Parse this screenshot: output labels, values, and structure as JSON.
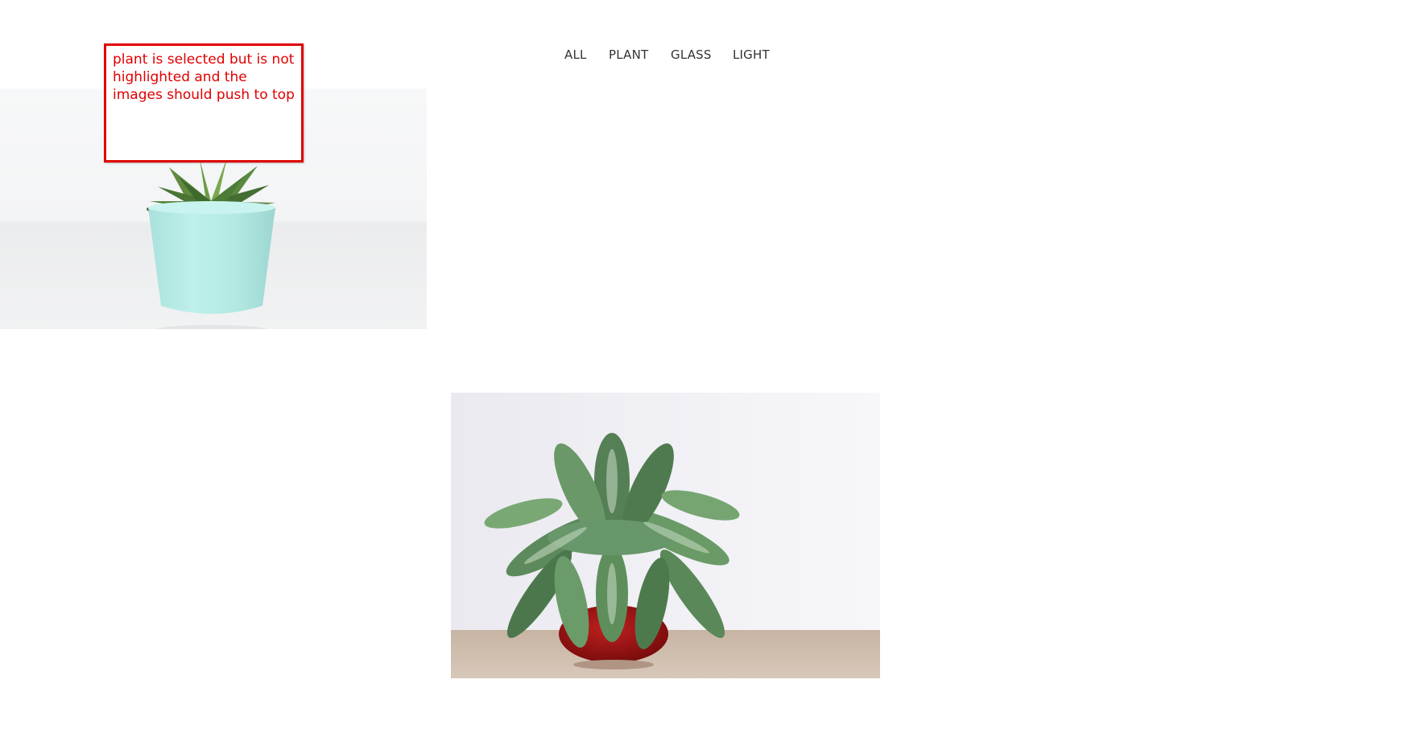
{
  "filters": {
    "items": [
      {
        "id": "all",
        "label": "ALL"
      },
      {
        "id": "plant",
        "label": "PLANT"
      },
      {
        "id": "glass",
        "label": "GLASS"
      },
      {
        "id": "light",
        "label": "LIGHT"
      }
    ],
    "selected": "plant",
    "text_color": "#333333"
  },
  "gallery": {
    "photos": [
      {
        "subject": "succulent in mint green pot",
        "category": "plant"
      },
      {
        "subject": "aglaonema in red glass bowl",
        "category": "plant"
      }
    ]
  },
  "annotation": {
    "text": "plant is selected but is not highlighted and the images should push to top",
    "color": "#e00000"
  }
}
